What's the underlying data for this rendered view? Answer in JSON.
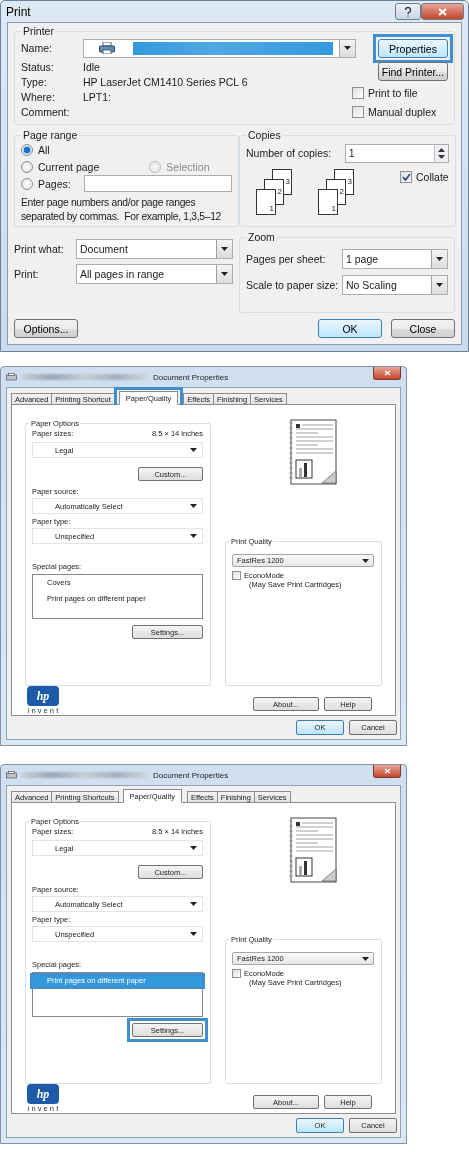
{
  "print_dialog": {
    "title": "Print",
    "printer": {
      "legend": "Printer",
      "name_label": "Name:",
      "properties_button": {
        "label": "Properties",
        "highlighted": true
      },
      "find_printer_button": "Find Printer...",
      "info": [
        {
          "label": "Status:",
          "value": "Idle"
        },
        {
          "label": "Type:",
          "value": "HP LaserJet CM1410 Series PCL 6"
        },
        {
          "label": "Where:",
          "value": "LPT1:"
        },
        {
          "label": "Comment:"
        }
      ],
      "checkboxes": [
        {
          "label": "Print to file",
          "checked": false
        },
        {
          "label": "Manual duplex",
          "checked": false
        }
      ]
    },
    "page_range": {
      "legend": "Page range",
      "radios": [
        {
          "label": "All",
          "selected": true,
          "disabled": false
        },
        {
          "label": "Current page",
          "selected": false,
          "disabled": false
        },
        {
          "label": "Selection",
          "selected": false,
          "disabled": true
        },
        {
          "label": "Pages:",
          "selected": false,
          "disabled": false
        }
      ],
      "hint": "Enter page numbers and/or page ranges separated by commas.  For example, 1,3,5–12"
    },
    "copies": {
      "legend": "Copies",
      "label": "Number of copies:",
      "value": "1",
      "stacks": [
        [
          "3",
          "2",
          "1"
        ],
        [
          "3",
          "2",
          "1"
        ]
      ],
      "collate": {
        "label": "Collate",
        "checked": true
      }
    },
    "print_what": {
      "label": "Print what:",
      "value": "Document"
    },
    "print": {
      "label": "Print:",
      "value": "All pages in range"
    },
    "zoom": {
      "legend": "Zoom",
      "rows": [
        {
          "label": "Pages per sheet:",
          "value": "1 page"
        },
        {
          "label": "Scale to paper size:",
          "value": "No Scaling"
        }
      ]
    },
    "buttons": {
      "options": "Options...",
      "ok": "OK",
      "close": "Close"
    }
  },
  "properties_dialogs": [
    {
      "title": "Document Properties",
      "tabs": [
        {
          "label": "Advanced",
          "selected": false,
          "highlighted": false
        },
        {
          "label": "Printing Shortcut",
          "selected": false,
          "highlighted": false
        },
        {
          "label": "Paper/Quality",
          "selected": true,
          "highlighted": true
        },
        {
          "label": "Effects",
          "selected": false,
          "highlighted": false
        },
        {
          "label": "Finishing",
          "selected": false,
          "highlighted": false
        },
        {
          "label": "Services",
          "selected": false,
          "highlighted": false
        }
      ],
      "paper_options": {
        "legend": "Paper Options",
        "sizes_label": "Paper sizes:",
        "dimensions": "8.5 × 14 inches",
        "size": "Legal",
        "custom_button": "Custom...",
        "source_label": "Paper source:",
        "source": "Automatically Select",
        "type_label": "Paper type:",
        "type": "Unspecified",
        "special_label": "Special pages:",
        "special_pages": [
          {
            "label": "Covers",
            "selected": false,
            "highlighted": false
          },
          {
            "label": "Print pages on different paper",
            "selected": false,
            "highlighted": false
          }
        ],
        "settings_button": {
          "label": "Settings...",
          "highlighted": false
        }
      },
      "print_quality": {
        "legend": "Print Quality",
        "value": "FastRes 1200",
        "econo": {
          "label": "EconoMode",
          "note": "(May Save Print Cartridges)",
          "checked": false
        }
      },
      "logo": {
        "mark": "hp",
        "tagline": "i n v e n t"
      },
      "buttons": {
        "about": "About...",
        "help": "Help",
        "ok": "OK",
        "cancel": "Cancel"
      }
    },
    {
      "title": "Document Properties",
      "tabs": [
        {
          "label": "Advanced",
          "selected": false,
          "highlighted": false
        },
        {
          "label": "Printing Shortcuts",
          "selected": false,
          "highlighted": false
        },
        {
          "label": "Paper/Quality",
          "selected": true,
          "highlighted": false
        },
        {
          "label": "Effects",
          "selected": false,
          "highlighted": false
        },
        {
          "label": "Finishing",
          "selected": false,
          "highlighted": false
        },
        {
          "label": "Services",
          "selected": false,
          "highlighted": false
        }
      ],
      "paper_options": {
        "legend": "Paper Options",
        "sizes_label": "Paper sizes:",
        "dimensions": "8.5 × 14 inches",
        "size": "Legal",
        "custom_button": "Custom...",
        "source_label": "Paper source:",
        "source": "Automatically Select",
        "type_label": "Paper type:",
        "type": "Unspecified",
        "special_label": "Special pages:",
        "special_pages": [
          {
            "label": "Print pages on different paper",
            "selected": true,
            "highlighted": true
          }
        ],
        "settings_button": {
          "label": "Settings...",
          "highlighted": true
        }
      },
      "print_quality": {
        "legend": "Print Quality",
        "value": "FastRes 1200",
        "econo": {
          "label": "EconoMode",
          "note": "(May Save Print Cartridges)",
          "checked": false
        }
      },
      "logo": {
        "mark": "hp",
        "tagline": "i n v e n t"
      },
      "buttons": {
        "about": "About...",
        "help": "Help",
        "ok": "OK",
        "cancel": "Cancel"
      }
    }
  ]
}
